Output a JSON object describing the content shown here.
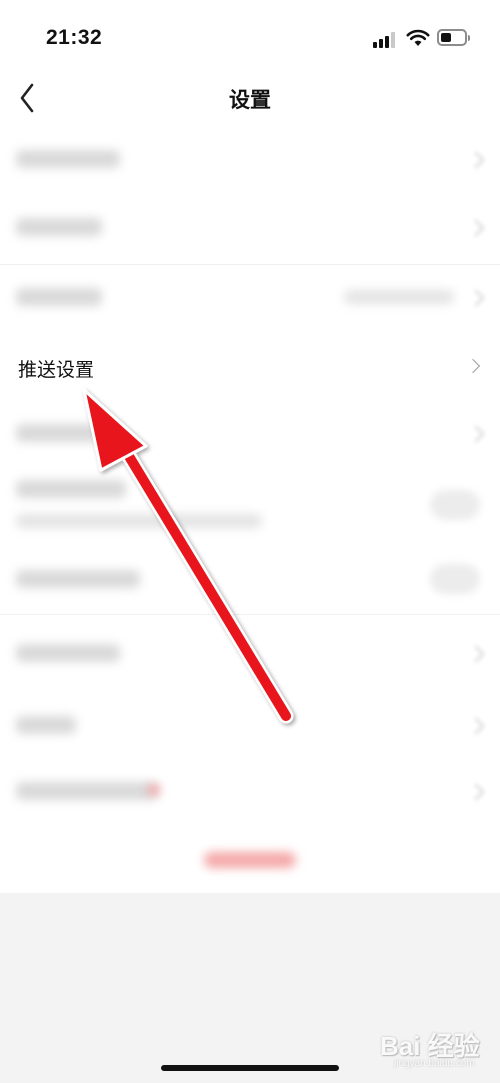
{
  "status_bar": {
    "time": "21:32"
  },
  "nav": {
    "title": "设置"
  },
  "settings": {
    "push_label": "推送设置"
  },
  "watermark": {
    "main": "Bai 经验",
    "sub": "jingyan.baidu.com"
  },
  "colors": {
    "arrow": "#e8121b",
    "accent_red": "#f2a1a1"
  },
  "icons": [
    "back-chevron-icon",
    "signal-icon",
    "wifi-icon",
    "battery-icon",
    "chevron-right-icon",
    "red-arrow-annotation"
  ]
}
